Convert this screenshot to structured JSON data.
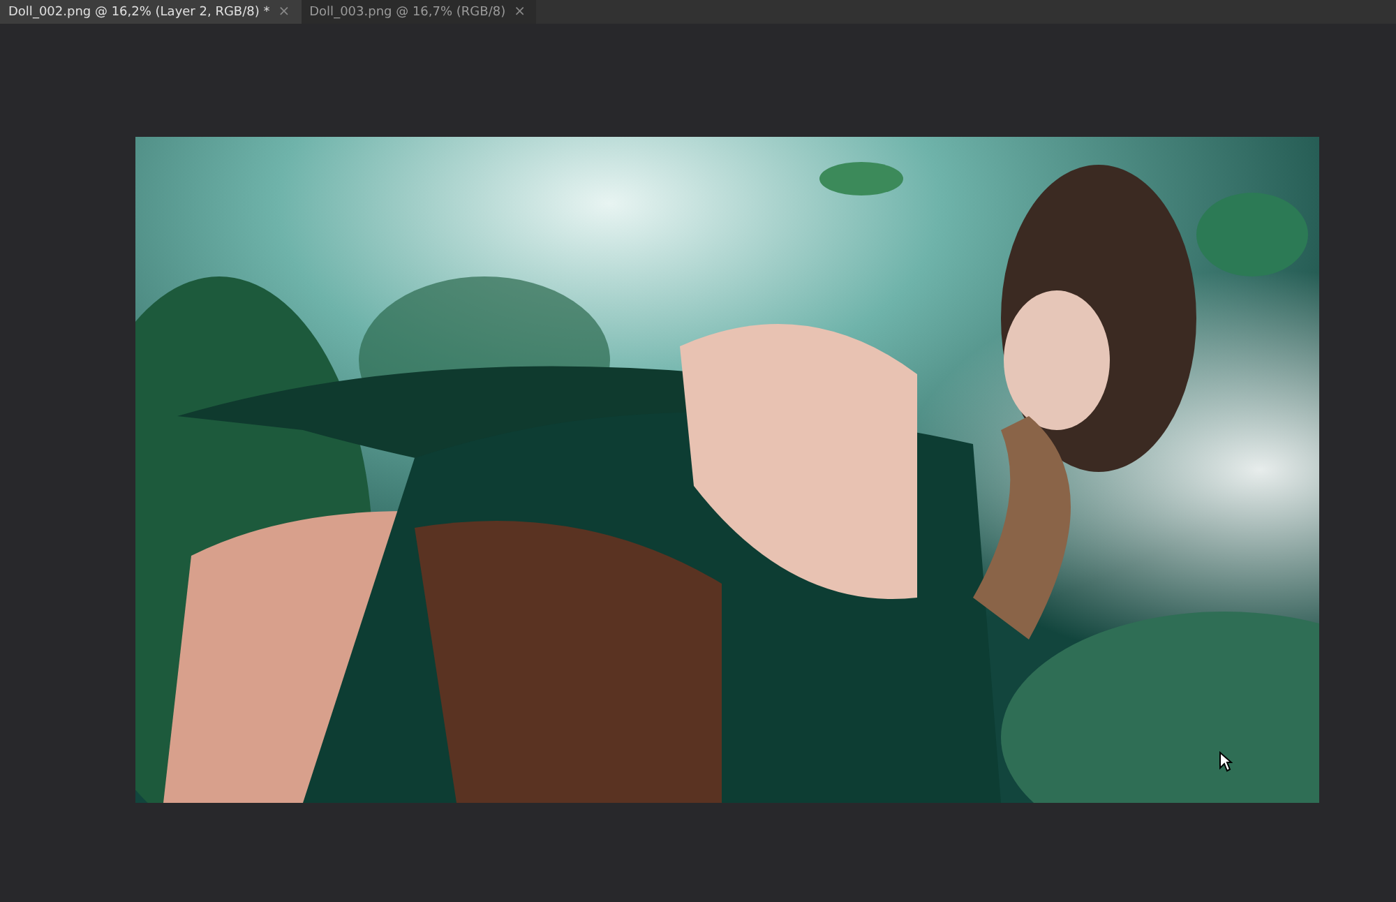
{
  "tabs": [
    {
      "label": "Doll_002.png @ 16,2% (Layer 2, RGB/8) *",
      "close": "×",
      "selected": true
    },
    {
      "label": "Doll_003.png @ 16,7% (RGB/8)",
      "close": "×",
      "selected": false
    }
  ]
}
